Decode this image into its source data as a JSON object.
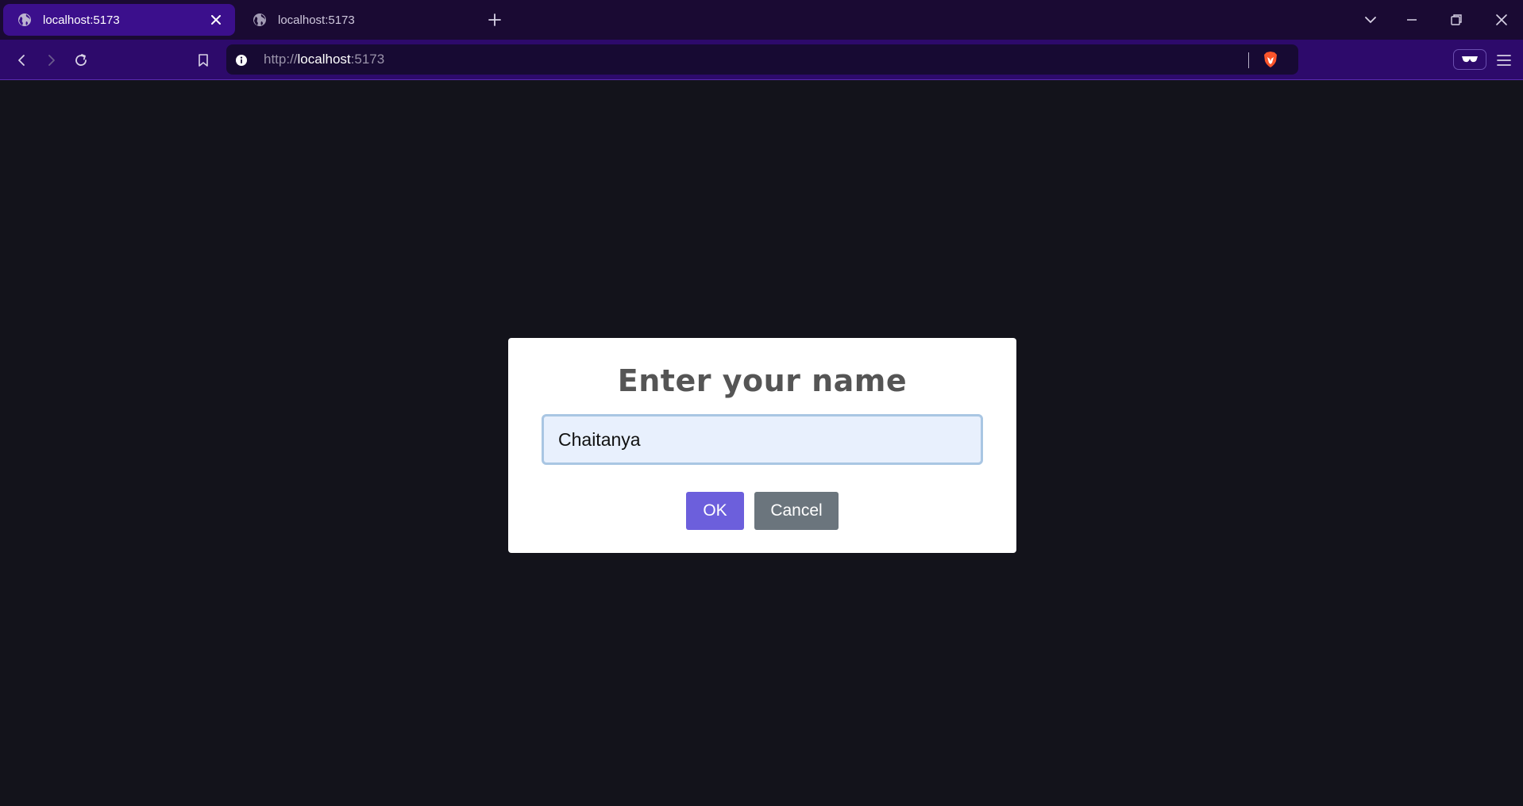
{
  "browser": {
    "tabs": [
      {
        "label": "localhost:5173",
        "active": true
      },
      {
        "label": "localhost:5173",
        "active": false
      }
    ],
    "address_bar": {
      "scheme": "http://",
      "host": "localhost",
      "port": ":5173"
    },
    "theme": {
      "tabstrip_bg": "#1a0a33",
      "active_tab_bg": "#3b0f8c",
      "toolbar_bg": "#2d0a6b"
    }
  },
  "dialog": {
    "title": "Enter your name",
    "input_value": "Chaitanya",
    "ok_label": "OK",
    "cancel_label": "Cancel",
    "ok_color": "#6c5fdc",
    "cancel_color": "#6b757d"
  },
  "icons": {
    "tab_favicon": "globe-icon",
    "new_tab": "plus-icon",
    "back": "chevron-left-icon",
    "forward": "chevron-right-icon",
    "reload": "reload-icon",
    "bookmark": "bookmark-icon",
    "site_info": "info-icon",
    "shields": "brave-lion-icon",
    "wallet": "glasses-icon",
    "menu": "hamburger-icon"
  }
}
